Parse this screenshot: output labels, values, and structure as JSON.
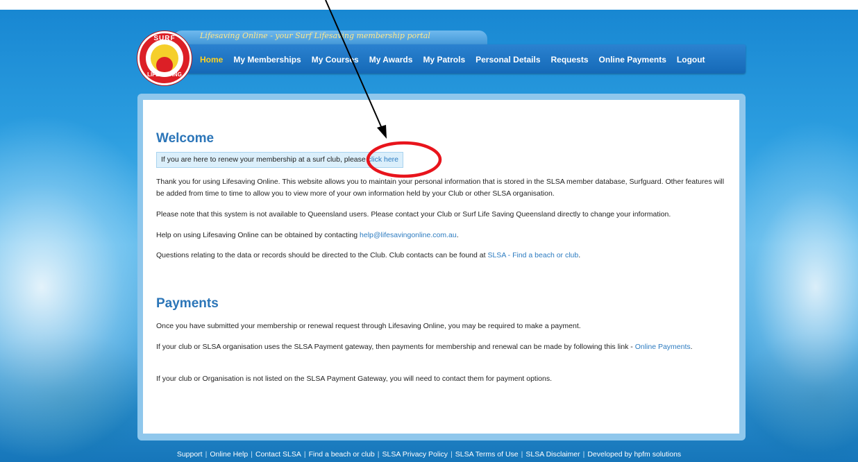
{
  "header": {
    "tagline": "Lifesaving Online - your Surf Lifesaving membership portal",
    "logo_top": "SURF",
    "logo_bottom": "LIFE SAVING",
    "nav": [
      {
        "label": "Home",
        "active": true
      },
      {
        "label": "My Memberships"
      },
      {
        "label": "My Courses"
      },
      {
        "label": "My Awards"
      },
      {
        "label": "My Patrols"
      },
      {
        "label": "Personal Details"
      },
      {
        "label": "Requests"
      },
      {
        "label": "Online Payments"
      },
      {
        "label": "Logout"
      }
    ]
  },
  "main": {
    "welcome_title": "Welcome",
    "renew_text": "If you are here to renew your membership at a surf club, please",
    "renew_link": "click here",
    "para1": "Thank you for using Lifesaving Online. This website allows you to maintain your personal information that is stored in the SLSA member database, Surfguard. Other features will be added from time to time to allow you to view more of your own information held by your Club or other SLSA organisation.",
    "para2": "Please note that this system is not available to Queensland users. Please contact your Club or Surf Life Saving Queensland directly to change your information.",
    "help_prefix": "Help on using Lifesaving Online can be obtained by contacting",
    "help_email": "help@lifesavingonline.com.au",
    "help_suffix": ".",
    "questions_prefix": "Questions relating to the data or records should be directed to the Club. Club contacts can be found at",
    "questions_link": "SLSA - Find a beach or club",
    "questions_suffix": ".",
    "payments_title": "Payments",
    "pay1": "Once you have submitted your membership or renewal request through Lifesaving Online, you may be required to make a payment.",
    "pay2_prefix": "If your club or SLSA organisation uses the SLSA Payment gateway, then payments for membership and renewal can be made by following this link -",
    "pay2_link": "Online Payments",
    "pay2_suffix": ".",
    "pay3": "If your club or Organisation is not listed on the SLSA Payment Gateway, you will need to contact them for payment options."
  },
  "footer": {
    "links": [
      "Support",
      "Online Help",
      "Contact SLSA",
      "Find a beach or club",
      "SLSA Privacy Policy",
      "SLSA Terms of Use",
      "SLSA Disclaimer",
      "Developed by hpfm solutions"
    ]
  },
  "colors": {
    "nav_active": "#ffd21f",
    "heading": "#2b75b8",
    "link": "#2c7bc0",
    "annotation": "#e8141c"
  }
}
